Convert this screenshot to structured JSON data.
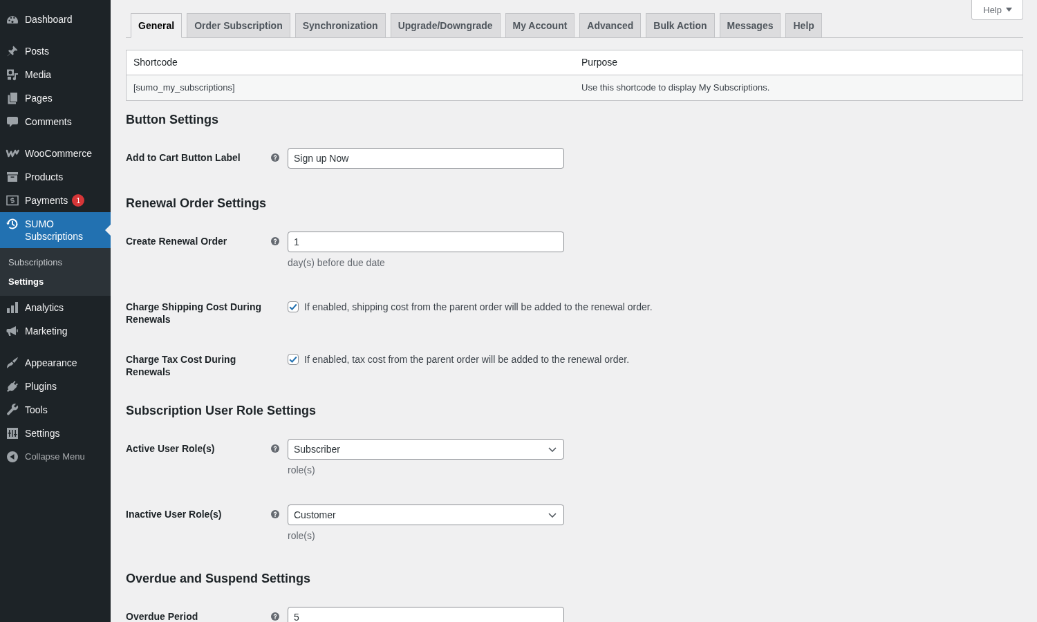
{
  "sidebar": {
    "groups": [
      {
        "items": [
          {
            "label": "Dashboard",
            "selected": false
          }
        ]
      },
      {
        "items": [
          {
            "label": "Posts",
            "selected": false
          },
          {
            "label": "Media",
            "selected": false
          },
          {
            "label": "Pages",
            "selected": false
          },
          {
            "label": "Comments",
            "selected": false
          }
        ]
      },
      {
        "items": [
          {
            "label": "WooCommerce",
            "selected": false
          },
          {
            "label": "Products",
            "selected": false
          },
          {
            "label": "Payments",
            "selected": false,
            "badge": "1"
          },
          {
            "label": "SUMO Subscriptions",
            "selected": true,
            "children": [
              {
                "label": "Subscriptions",
                "selected": false
              },
              {
                "label": "Settings",
                "selected": true
              }
            ]
          },
          {
            "label": "Analytics",
            "selected": false
          },
          {
            "label": "Marketing",
            "selected": false
          }
        ]
      },
      {
        "items": [
          {
            "label": "Appearance",
            "selected": false
          },
          {
            "label": "Plugins",
            "selected": false
          },
          {
            "label": "Tools",
            "selected": false
          },
          {
            "label": "Settings",
            "selected": false
          }
        ]
      }
    ],
    "collapse_label": "Collapse Menu"
  },
  "help_button": {
    "label": "Help"
  },
  "tabs": [
    {
      "label": "General",
      "selected": true
    },
    {
      "label": "Order Subscription",
      "selected": false
    },
    {
      "label": "Synchronization",
      "selected": false
    },
    {
      "label": "Upgrade/Downgrade",
      "selected": false
    },
    {
      "label": "My Account",
      "selected": false
    },
    {
      "label": "Advanced",
      "selected": false
    },
    {
      "label": "Bulk Action",
      "selected": false
    },
    {
      "label": "Messages",
      "selected": false
    },
    {
      "label": "Help",
      "selected": false
    }
  ],
  "shortcode_table": {
    "columns": [
      "Shortcode",
      "Purpose"
    ],
    "rows": [
      [
        "[sumo_my_subscriptions]",
        "Use this shortcode to display My Subscriptions."
      ]
    ]
  },
  "sections": [
    {
      "title": "Button Settings",
      "fields": [
        {
          "kind": "text",
          "label": "Add to Cart Button Label",
          "help_tip": true,
          "value": "Sign up Now"
        }
      ]
    },
    {
      "title": "Renewal Order Settings",
      "fields": [
        {
          "kind": "text",
          "label": "Create Renewal Order",
          "help_tip": true,
          "value": "1",
          "description": "day(s) before due date"
        },
        {
          "kind": "checkbox",
          "label": "Charge Shipping Cost During Renewals",
          "checked": true,
          "description": "If enabled, shipping cost from the parent order will be added to the renewal order."
        },
        {
          "kind": "checkbox",
          "label": "Charge Tax Cost During Renewals",
          "checked": true,
          "description": "If enabled, tax cost from the parent order will be added to the renewal order."
        }
      ]
    },
    {
      "title": "Subscription User Role Settings",
      "fields": [
        {
          "kind": "select",
          "label": "Active User Role(s)",
          "help_tip": true,
          "value": "Subscriber",
          "description": "role(s)"
        },
        {
          "kind": "select",
          "label": "Inactive User Role(s)",
          "help_tip": true,
          "value": "Customer",
          "description": "role(s)"
        }
      ]
    },
    {
      "title": "Overdue and Suspend Settings",
      "fields": [
        {
          "kind": "text",
          "label": "Overdue Period",
          "help_tip": true,
          "value": "5"
        }
      ]
    }
  ]
}
